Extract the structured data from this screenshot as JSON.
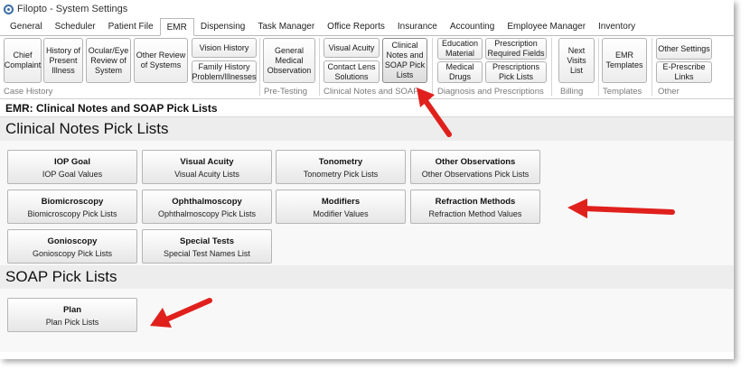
{
  "window": {
    "title": "Filopto - System Settings"
  },
  "tabs": [
    "General",
    "Scheduler",
    "Patient File",
    "EMR",
    "Dispensing",
    "Task Manager",
    "Office Reports",
    "Insurance",
    "Accounting",
    "Employee Manager",
    "Inventory"
  ],
  "active_tab": "EMR",
  "ribbon": {
    "case_history": {
      "label": "Case History",
      "chief_complaint": "Chief Complaint",
      "history_present_illness": "History of Present Illness",
      "ocular_eye_review": "Ocular/Eye Review of System",
      "other_review": "Other Review of Systems",
      "vision_history": "Vision History",
      "family_history": "Family History Problem/Illnesses"
    },
    "pre_testing": {
      "label": "Pre-Testing",
      "general_medical": "General Medical Observation"
    },
    "clinical_notes_soap": {
      "label": "Clinical Notes and SOAP",
      "visual_acuity": "Visual Acuity",
      "contact_lens": "Contact Lens Solutions",
      "clinical_notes_pick": "Clinical Notes and SOAP Pick Lists"
    },
    "diagnosis_prescriptions": {
      "label": "Diagnosis and Prescriptions",
      "education_material": "Education Material",
      "prescription_required": "Prescription Required Fields",
      "medical_drugs": "Medical Drugs",
      "prescriptions_pick": "Prescriptions Pick Lists"
    },
    "billing": {
      "label": "Billing",
      "next_visits": "Next Visits List"
    },
    "templates": {
      "label": "Templates",
      "emr_templates": "EMR Templates"
    },
    "other": {
      "label": "Other",
      "other_settings": "Other Settings",
      "e_prescribe": "E-Prescribe Links"
    }
  },
  "page_title": "EMR: Clinical Notes and SOAP Pick Lists",
  "clinical_section": {
    "title": "Clinical Notes Pick Lists",
    "buttons": [
      {
        "title": "IOP Goal",
        "subtitle": "IOP Goal Values"
      },
      {
        "title": "Visual Acuity",
        "subtitle": "Visual Acuity Lists"
      },
      {
        "title": "Tonometry",
        "subtitle": "Tonometry Pick Lists"
      },
      {
        "title": "Other Observations",
        "subtitle": "Other Observations Pick Lists"
      },
      {
        "title": "Biomicroscopy",
        "subtitle": "Biomicroscopy Pick Lists"
      },
      {
        "title": "Ophthalmoscopy",
        "subtitle": "Ophthalmoscopy Pick Lists"
      },
      {
        "title": "Modifiers",
        "subtitle": "Modifier Values"
      },
      {
        "title": "Refraction Methods",
        "subtitle": "Refraction Method Values"
      },
      {
        "title": "Gonioscopy",
        "subtitle": "Gonioscopy Pick Lists"
      },
      {
        "title": "Special Tests",
        "subtitle": "Special Test Names List"
      }
    ]
  },
  "soap_section": {
    "title": "SOAP Pick Lists",
    "buttons": [
      {
        "title": "Plan",
        "subtitle": "Plan Pick Lists"
      }
    ]
  },
  "colors": {
    "annotation_arrow": "#e0201c",
    "section_header_bg": "#ededed"
  }
}
